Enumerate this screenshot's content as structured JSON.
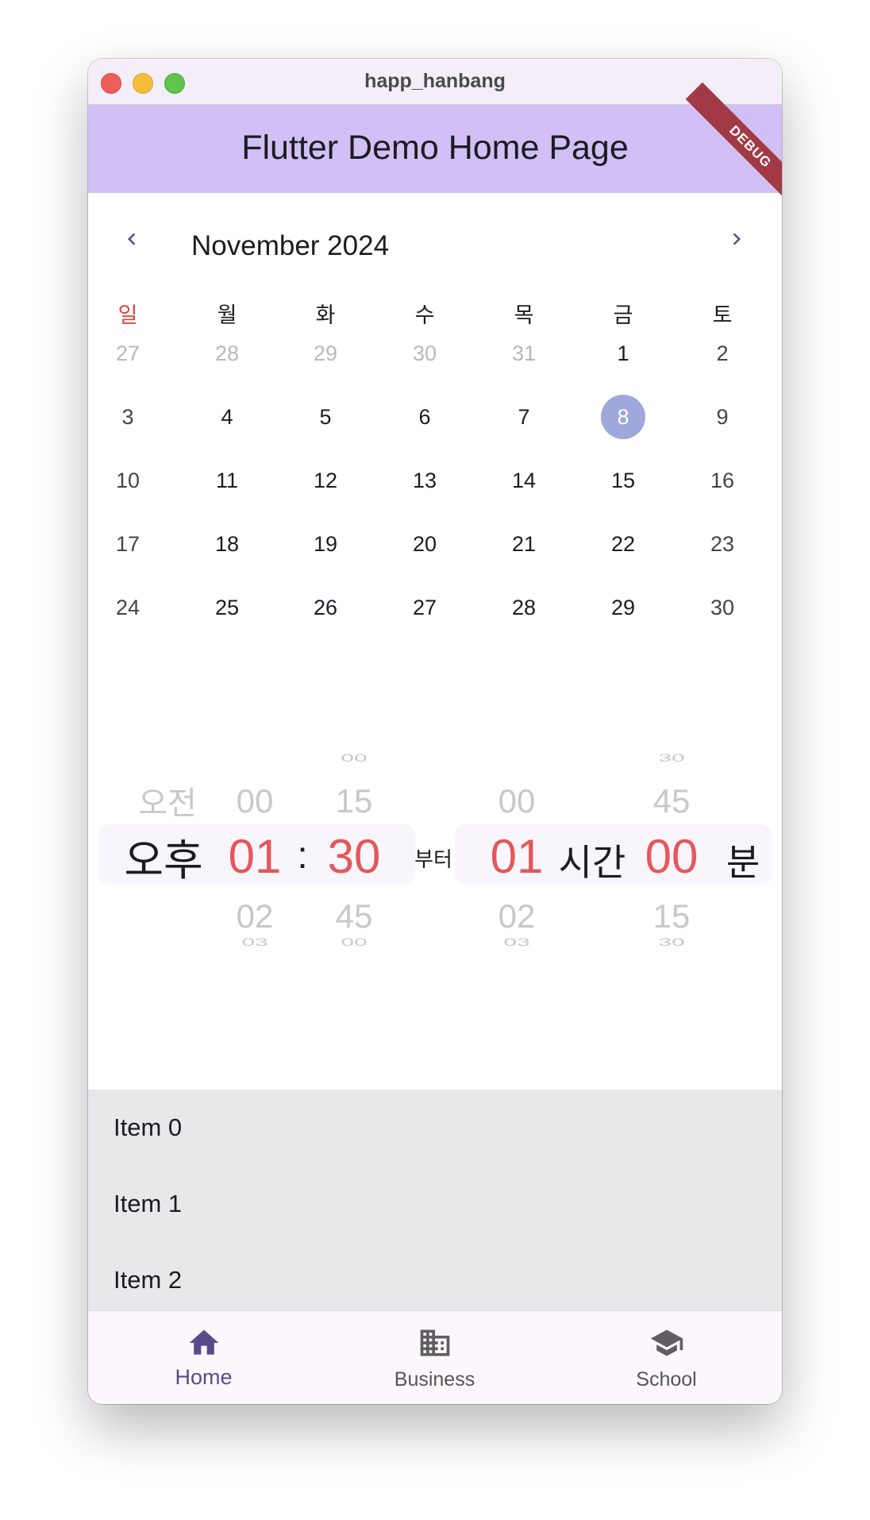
{
  "window": {
    "title": "happ_hanbang"
  },
  "appbar": {
    "title": "Flutter Demo Home Page",
    "debug_banner": "DEBUG",
    "color": "#d1bff6"
  },
  "calendar": {
    "month_label": "November 2024",
    "prev_icon": "chevron-left-icon",
    "next_icon": "chevron-right-icon",
    "weekdays": [
      "일",
      "월",
      "화",
      "수",
      "목",
      "금",
      "토"
    ],
    "weeks": [
      [
        "27",
        "28",
        "29",
        "30",
        "31",
        "1",
        "2"
      ],
      [
        "3",
        "4",
        "5",
        "6",
        "7",
        "8",
        "9"
      ],
      [
        "10",
        "11",
        "12",
        "13",
        "14",
        "15",
        "16"
      ],
      [
        "17",
        "18",
        "19",
        "20",
        "21",
        "22",
        "23"
      ],
      [
        "24",
        "25",
        "26",
        "27",
        "28",
        "29",
        "30"
      ]
    ],
    "selected_day": "8",
    "selected_color": "#9fa8da"
  },
  "time_picker": {
    "ampm": {
      "above": "오전",
      "selected": "오후"
    },
    "hour": {
      "above": "00",
      "selected": "01",
      "below1": "02",
      "below2": "03"
    },
    "separator": ":",
    "minute": {
      "above2": "00",
      "above": "15",
      "selected": "30",
      "below1": "45",
      "below2": "00"
    },
    "from_label": "부터",
    "duration_hours": {
      "above": "00",
      "selected": "01",
      "below1": "02",
      "below2": "03"
    },
    "hours_unit": "시간",
    "duration_minutes": {
      "above2": "30",
      "above": "45",
      "selected": "00",
      "below1": "15",
      "below2": "30"
    },
    "minutes_unit": "분",
    "accent_color": "#e5575a"
  },
  "list": {
    "items": [
      "Item 0",
      "Item 1",
      "Item 2"
    ]
  },
  "bottom_nav": {
    "items": [
      {
        "label": "Home",
        "icon": "home-icon",
        "active": true
      },
      {
        "label": "Business",
        "icon": "business-icon",
        "active": false
      },
      {
        "label": "School",
        "icon": "school-icon",
        "active": false
      }
    ],
    "active_color": "#5a4a8a",
    "inactive_color": "#555555"
  }
}
